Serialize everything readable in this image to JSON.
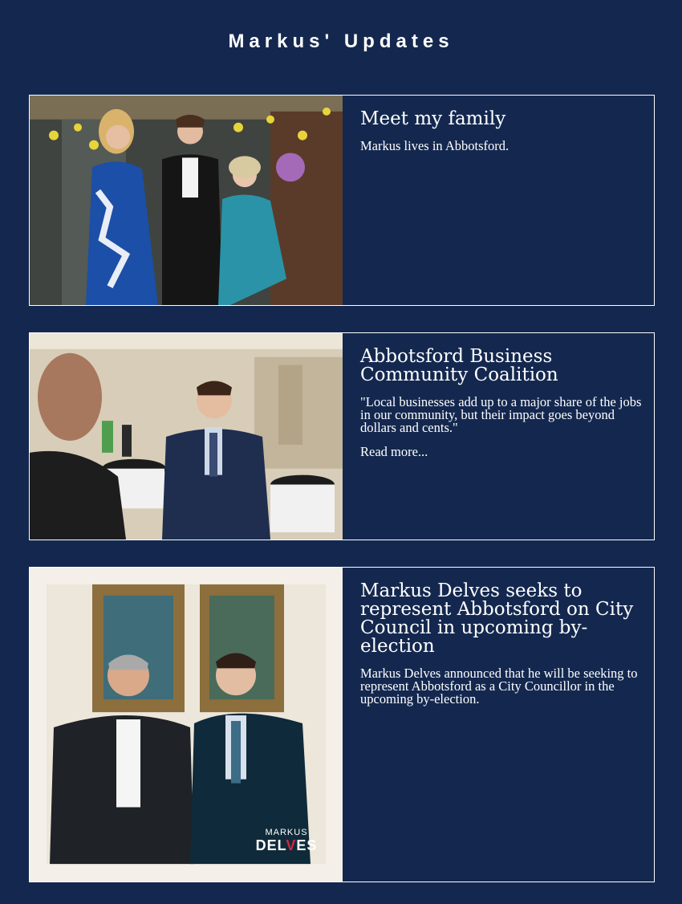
{
  "page": {
    "title": "Markus' Updates"
  },
  "colors": {
    "background": "#14284f",
    "text": "#ffffff",
    "accent_red": "#d7263d"
  },
  "posts": [
    {
      "title": "Meet my family",
      "body": "Markus lives in Abbotsford.",
      "read_more": "",
      "photo_icon": "family-photo"
    },
    {
      "title": "Abbotsford Business Community Coalition",
      "body": "\"Local businesses add up to a major share of the jobs in our community, but their impact goes beyond dollars and cents.\"",
      "read_more": "Read more...",
      "photo_icon": "business-event-photo"
    },
    {
      "title": "Markus Delves seeks to represent Abbotsford on City Council in upcoming by-election",
      "body": "Markus Delves announced that he will be seeking to represent Abbotsford as a City Councillor in the upcoming by-election.",
      "read_more": "",
      "photo_icon": "campaign-photo",
      "logo": {
        "top": "MARKUS",
        "bottom_left": "DEL",
        "bottom_mark": "V",
        "bottom_right": "ES"
      }
    }
  ]
}
